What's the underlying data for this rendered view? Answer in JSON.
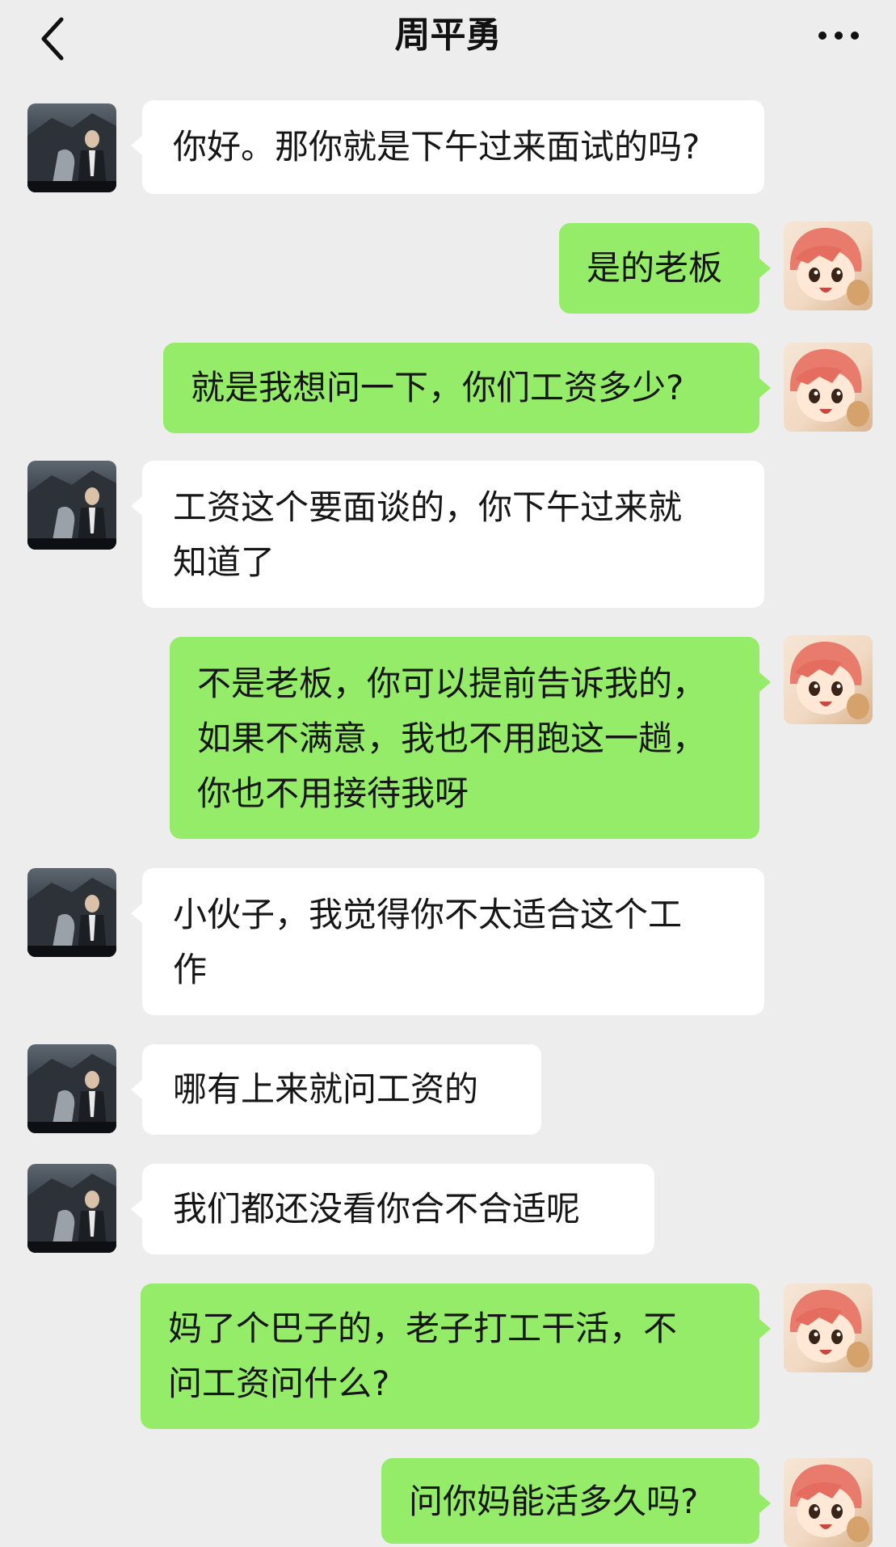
{
  "header": {
    "title": "周平勇",
    "back_icon": "chevron-left-icon",
    "more_icon": "ellipsis-icon"
  },
  "messages": [
    {
      "side": "left",
      "lines": [
        "你好。那你就是下午过来面试的吗?"
      ]
    },
    {
      "side": "right",
      "lines": [
        "是的老板"
      ]
    },
    {
      "side": "right",
      "lines": [
        "就是我想问一下，你们工资多少?"
      ]
    },
    {
      "side": "left",
      "lines": [
        "工资这个要面谈的，你下午过来就",
        "知道了"
      ]
    },
    {
      "side": "right",
      "lines": [
        "不是老板，你可以提前告诉我的，",
        "如果不满意，我也不用跑这一趟，",
        "你也不用接待我呀"
      ]
    },
    {
      "side": "left",
      "lines": [
        "小伙子，我觉得你不太适合这个工",
        "作"
      ]
    },
    {
      "side": "left",
      "lines": [
        "哪有上来就问工资的"
      ]
    },
    {
      "side": "left",
      "lines": [
        "我们都还没看你合不合适呢"
      ]
    },
    {
      "side": "right",
      "lines": [
        "妈了个巴子的，老子打工干活，不",
        "问工资问什么?"
      ]
    },
    {
      "side": "right",
      "lines": [
        "问你妈能活多久吗?"
      ]
    }
  ],
  "colors": {
    "background": "#ededed",
    "sent_bubble": "#95ec69",
    "received_bubble": "#ffffff"
  }
}
